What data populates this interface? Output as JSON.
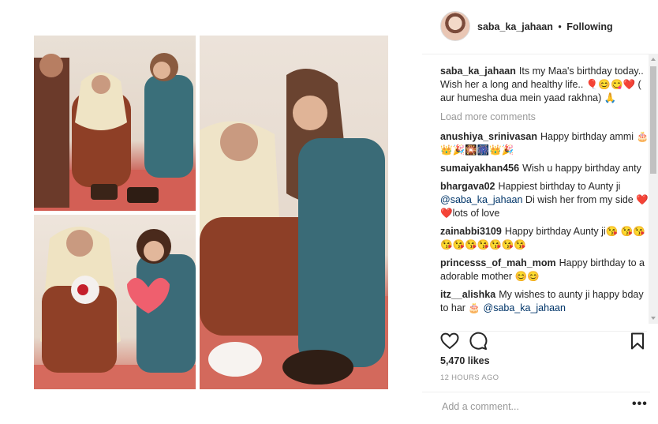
{
  "post": {
    "username": "saba_ka_jahaan",
    "separator": "•",
    "follow_state": "Following"
  },
  "caption": {
    "username": "saba_ka_jahaan",
    "text": "Its my Maa's birthday today.. Wish her a long and healthy life.. 🎈😊😋❤️ ( aur humesha dua mein yaad rakhna) 🙏"
  },
  "load_more_label": "Load more comments",
  "comments": [
    {
      "username": "anushiya_srinivasan",
      "text": "Happy birthday ammi 🎂👑🎉🎇🎆👑🎉"
    },
    {
      "username": "sumaiyakhan456",
      "text": "Wish u happy birthday anty"
    },
    {
      "username": "bhargava02",
      "text": "Happiest birthday to Aunty ji",
      "mention": "@saba_ka_jahaan",
      "text2": "Di wish her from my side ❤️❤️lots of love"
    },
    {
      "username": "zainabbi3109",
      "text": "Happy birthday Aunty ji😘 😘😘😘😘😘😘😘😘😘"
    },
    {
      "username": "princesss_of_mah_mom",
      "text": "Happy birthday to a adorable mother 😊😊"
    },
    {
      "username": "itz__alishka",
      "text": "My wishes to aunty ji happy bday to har 🎂",
      "mention": "@saba_ka_jahaan"
    }
  ],
  "actions": {
    "like_icon": "heart-icon",
    "comment_icon": "comment-bubble-icon",
    "save_icon": "bookmark-icon"
  },
  "likes_label": "5,470 likes",
  "timestamp": "12 HOURS AGO",
  "add_comment_placeholder": "Add a comment...",
  "more_options": "•••",
  "colors": {
    "text": "#262626",
    "muted": "#999999",
    "mention": "#003569",
    "divider": "#efefef"
  }
}
